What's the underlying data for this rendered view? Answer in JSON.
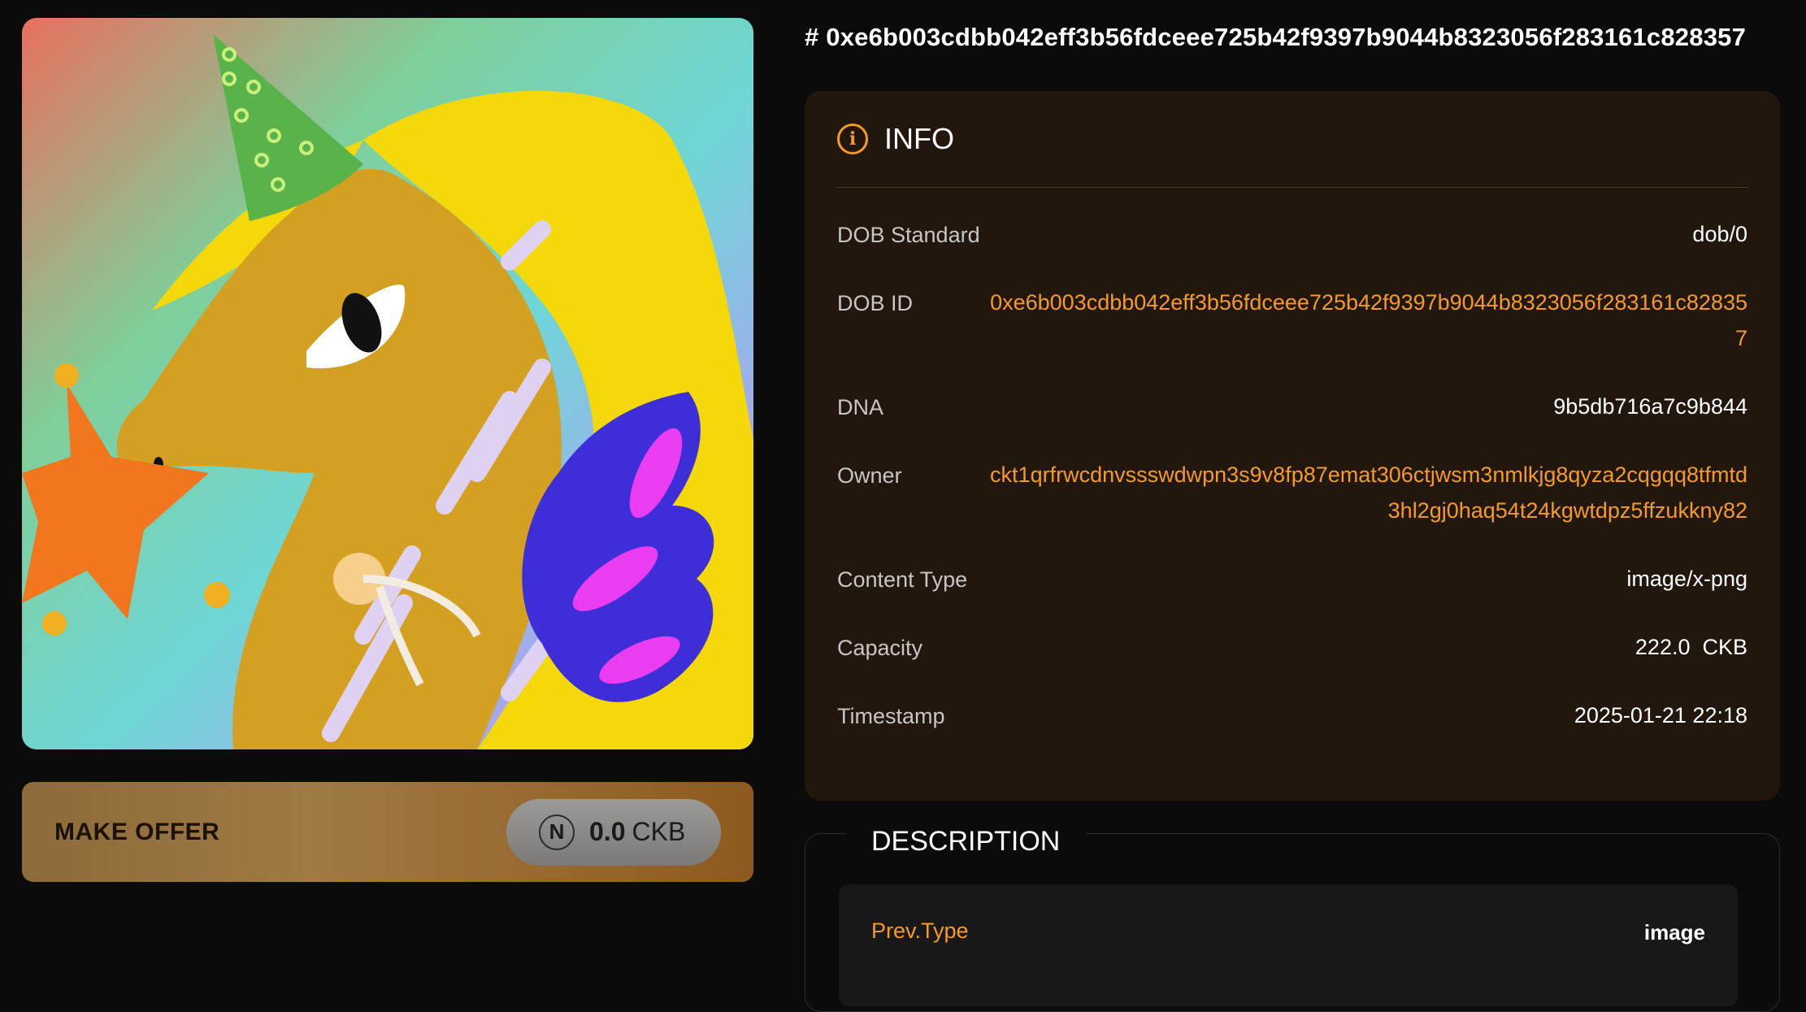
{
  "page_title": "# 0xe6b003cdbb042eff3b56fdceee725b42f9397b9044b8323056f283161c828357",
  "artwork": {
    "alt": "",
    "icon": "unicorn-artwork"
  },
  "offer": {
    "label": "MAKE OFFER",
    "price": "0.0",
    "unit": "CKB",
    "logo_glyph": "N"
  },
  "info": {
    "icon_glyph": "i",
    "title": "INFO",
    "rows": [
      {
        "key": "DOB Standard",
        "value": "dob/0"
      },
      {
        "key": "DOB ID",
        "value": "0xe6b003cdbb042eff3b56fdceee725b42f9397b9044b8323056f283161c828357"
      },
      {
        "key": "DNA",
        "value": "9b5db716a7c9b844"
      },
      {
        "key": "Owner",
        "value": "ckt1qrfrwcdnvssswdwpn3s9v8fp87emat306ctjwsm3nmlkjg8qyza2cqgqq8tfmtd3hl2gj0haq54t24kgwtdpz5ffzukkny82"
      },
      {
        "key": "Content Type",
        "value": "image/x-png"
      },
      {
        "key": "Capacity",
        "value": "222.0  CKB"
      },
      {
        "key": "Timestamp",
        "value": "2025-01-21 22:18"
      }
    ]
  },
  "description": {
    "title": "DESCRIPTION",
    "rows": [
      {
        "key": "Prev.Type",
        "value": "image"
      }
    ]
  },
  "colors": {
    "accent_orange": "#f59a23",
    "card_bg": "#22170d",
    "page_bg": "#0b0b0b"
  }
}
